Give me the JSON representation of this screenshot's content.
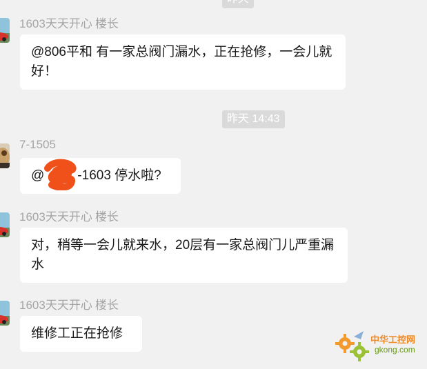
{
  "chat": {
    "top_timestamp": "昨天",
    "divider_timestamp": "昨天 14:43",
    "messages": [
      {
        "sender": "1603天天开心",
        "role": "楼长",
        "text": "@806平和 有一家总阀门漏水，正在抢修，一会儿就好！"
      },
      {
        "sender": "7-1505",
        "role": "",
        "text_prefix": "@",
        "text_suffix": "-1603 停水啦?"
      },
      {
        "sender": "1603天天开心",
        "role": "楼长",
        "text": "对，稍等一会儿就来水，20层有一家总阀门儿严重漏水"
      },
      {
        "sender": "1603天天开心",
        "role": "楼长",
        "text": "维修工正在抢修"
      }
    ]
  },
  "watermark": {
    "name_cn": "中华工控网",
    "domain": "gkong.com"
  },
  "colors": {
    "background": "#f1f1f1",
    "bubble": "#ffffff",
    "timestamp_bg": "#dadada",
    "sender_text": "#a5a5a5",
    "scribble": "#f0511a"
  }
}
